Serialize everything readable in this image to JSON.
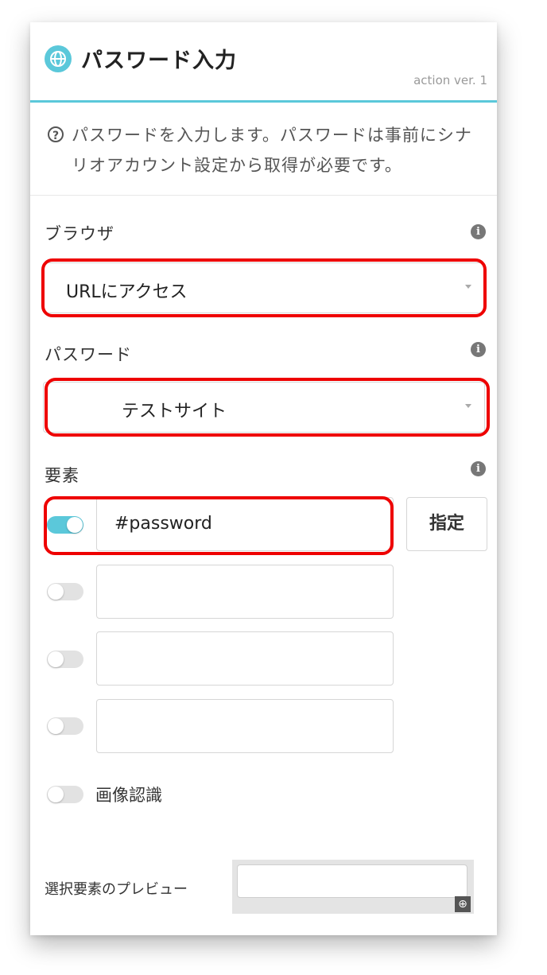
{
  "header": {
    "title": "パスワード入力",
    "version": "action ver. 1"
  },
  "description": "パスワードを入力します。パスワードは事前にシナリオアカウント設定から取得が必要です。",
  "browser": {
    "label": "ブラウザ",
    "value": "URLにアクセス"
  },
  "password": {
    "label": "パスワード",
    "value": "テストサイト"
  },
  "elements": {
    "label": "要素",
    "specify_label": "指定",
    "rows": [
      {
        "enabled": true,
        "value": "#password"
      },
      {
        "enabled": false,
        "value": ""
      },
      {
        "enabled": false,
        "value": ""
      },
      {
        "enabled": false,
        "value": ""
      }
    ]
  },
  "image_recognition": {
    "label": "画像認識",
    "enabled": false
  },
  "preview": {
    "label": "選択要素のプレビュー"
  },
  "colors": {
    "accent": "#5bc8da",
    "highlight": "#e00000"
  }
}
